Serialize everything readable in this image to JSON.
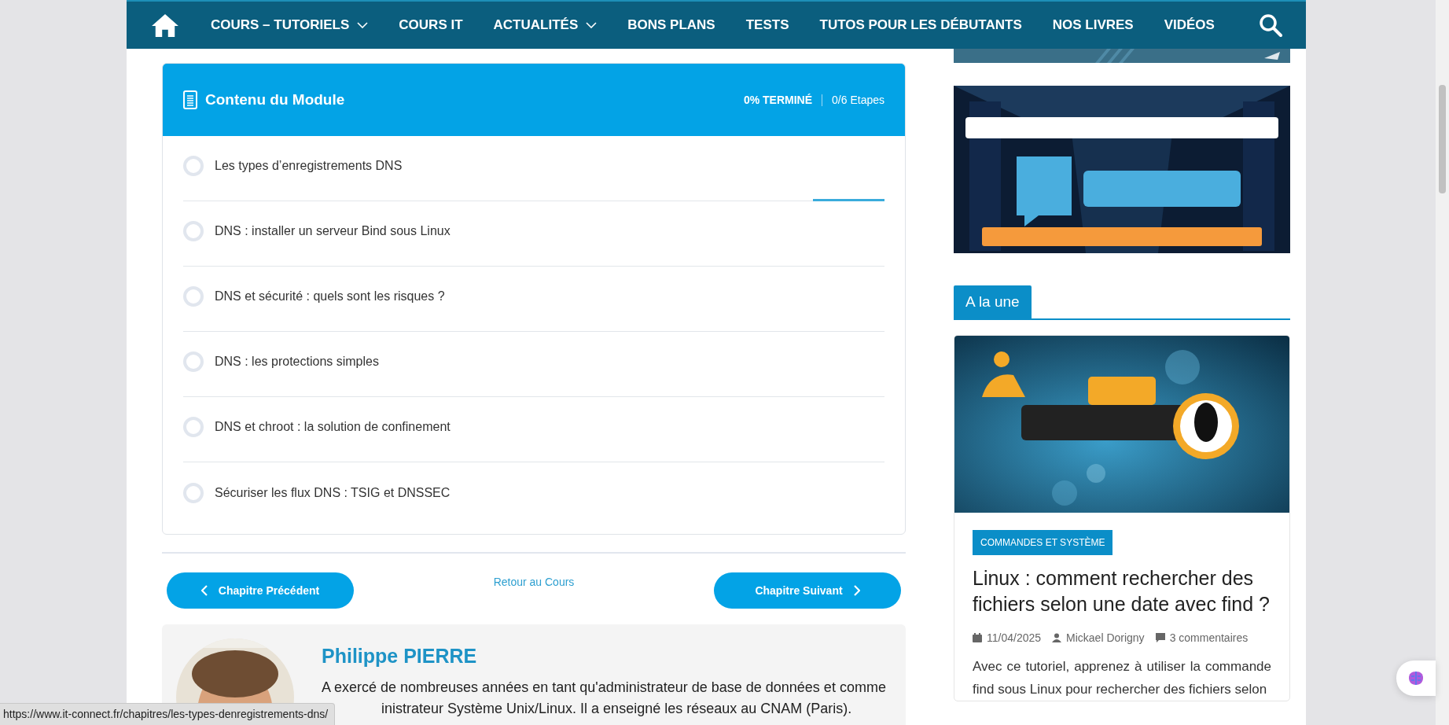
{
  "nav": {
    "items": [
      {
        "label": "COURS – TUTORIELS",
        "dropdown": true
      },
      {
        "label": "COURS IT",
        "dropdown": false
      },
      {
        "label": "ACTUALITÉS",
        "dropdown": true
      },
      {
        "label": "BONS PLANS",
        "dropdown": false
      },
      {
        "label": "TESTS",
        "dropdown": false
      },
      {
        "label": "TUTOS POUR LES DÉBUTANTS",
        "dropdown": false
      },
      {
        "label": "NOS LIVRES",
        "dropdown": false
      },
      {
        "label": "VIDÉOS",
        "dropdown": false
      }
    ]
  },
  "module": {
    "title": "Contenu du Module",
    "progress": "0% TERMINÉ",
    "steps": "0/6 Etapes",
    "lessons": [
      {
        "title": "Les types d’enregistrements DNS",
        "checked": false,
        "selected": true
      },
      {
        "title": "DNS : installer un serveur Bind sous Linux",
        "checked": false,
        "selected": false
      },
      {
        "title": "DNS et sécurité : quels sont les risques ?",
        "checked": false,
        "selected": false
      },
      {
        "title": "DNS : les protections simples",
        "checked": false,
        "selected": false
      },
      {
        "title": "DNS et chroot : la solution de confinement",
        "checked": false,
        "selected": false
      },
      {
        "title": "Sécuriser les flux DNS : TSIG et DNSSEC",
        "checked": false,
        "selected": false
      }
    ]
  },
  "pagination": {
    "previous": "Chapitre Précédent",
    "back": "Retour au Cours",
    "next": "Chapitre Suivant"
  },
  "author": {
    "name": "Philippe PIERRE",
    "bio_line_1": "A exercé de nombreuses années en tant qu'administrateur de base de données et comme",
    "bio_line_2": "inistrateur Système Unix/Linux. Il a enseigné les réseaux au CNAM (Paris)."
  },
  "sidebar": {
    "section_title": "A la une",
    "article": {
      "category": "COMMANDES ET SYSTÈME",
      "title": "Linux : comment rechercher des fichiers selon une date avec find ?",
      "date": "11/04/2025",
      "author": "Mickael Dorigny",
      "comments": "3 commentaires",
      "excerpt": "Avec ce tutoriel, apprenez à utiliser la commande find sous Linux pour rechercher des fichiers selon"
    }
  },
  "status_bar": {
    "url": "https://www.it-connect.fr/chapitres/les-types-denregistrements-dns/"
  }
}
